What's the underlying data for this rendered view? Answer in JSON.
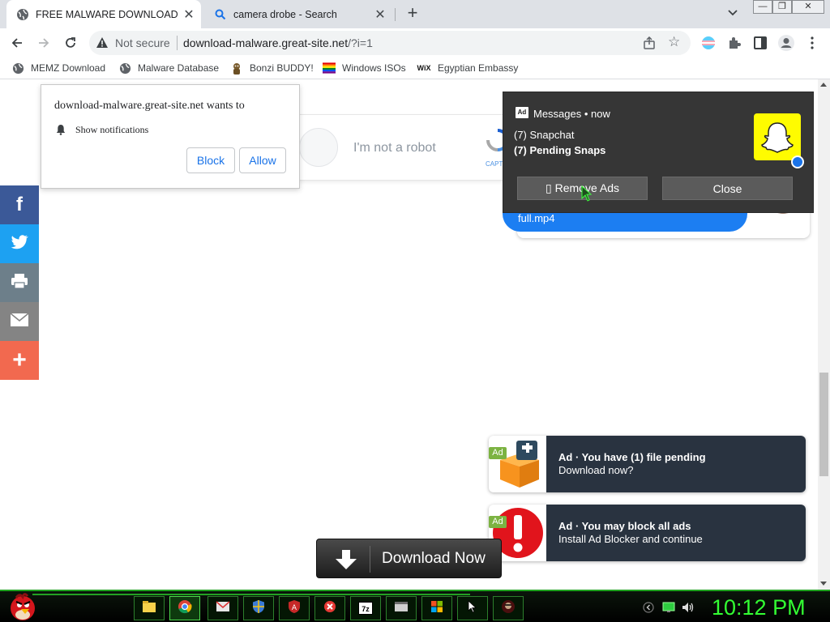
{
  "tabs": [
    {
      "title": "FREE MALWARE DOWNLOAD",
      "icon": "globe-icon",
      "active": true
    },
    {
      "title": "camera drobe - Search",
      "icon": "search-icon",
      "active": false
    }
  ],
  "toolbar": {
    "security_label": "Not secure",
    "url_domain": "download-malware.great-site.net",
    "url_path": "/?i=1"
  },
  "bookmarks": [
    {
      "label": "MEMZ Download",
      "icon": "globe-icon"
    },
    {
      "label": "Malware Database",
      "icon": "globe-icon"
    },
    {
      "label": "Bonzi BUDDY!",
      "icon": "bonzi-icon"
    },
    {
      "label": "Windows ISOs",
      "icon": "rainbow-flag-icon"
    },
    {
      "label": "Egyptian Embassy",
      "icon": "wix-icon"
    }
  ],
  "permission_prompt": {
    "title": "download-malware.great-site.net wants to",
    "request": "Show notifications",
    "block_label": "Block",
    "allow_label": "Allow"
  },
  "captcha": {
    "label": "I'm not a robot",
    "brand": "CAPT"
  },
  "social": [
    {
      "name": "facebook",
      "icon": "facebook-icon",
      "color": "#3b5998"
    },
    {
      "name": "twitter",
      "icon": "twitter-icon",
      "color": "#1da1f2"
    },
    {
      "name": "print",
      "icon": "print-icon",
      "color": "#6d7f8a"
    },
    {
      "name": "email",
      "icon": "email-icon",
      "color": "#848484"
    },
    {
      "name": "more",
      "icon": "plus-icon",
      "color": "#f2694f"
    }
  ],
  "messages_popup": {
    "ad_tag": "Ad",
    "header": "Messages • now",
    "line1": "(7) Snapchat",
    "line2": "(7) Pending Snaps",
    "remove_ads_label": "▯ Remove Ads",
    "close_label": "Close",
    "background_filename": "full.mp4"
  },
  "ads": [
    {
      "tag": "Ad",
      "title": "Ad · You have (1) file pending",
      "subtitle": "Download now?",
      "icon": "package-icon"
    },
    {
      "tag": "Ad",
      "title": "Ad · You may block all ads",
      "subtitle": "Install Ad Blocker and continue",
      "icon": "alert-icon"
    }
  ],
  "download_button": {
    "label": "Download Now"
  },
  "taskbar": {
    "apps": [
      "file-explorer-icon",
      "chrome-icon",
      "mail-icon",
      "shield-icon",
      "antivirus-icon",
      "x-icon",
      "7zip-icon",
      "window-icon",
      "windows-logo-icon",
      "cursor-icon",
      "hacker-icon"
    ],
    "clock": "10:12 PM"
  },
  "colors": {
    "accent_blue": "#1a73e8",
    "taskbar_green": "#33ff33",
    "snapchat_yellow": "#fffc00",
    "ad_dark": "#293340"
  }
}
